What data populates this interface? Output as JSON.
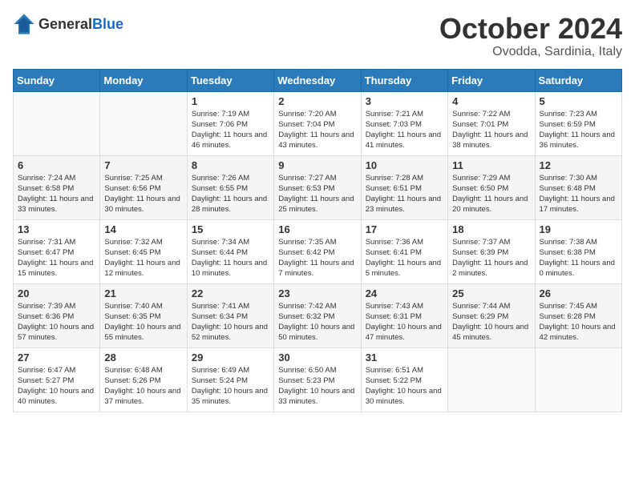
{
  "header": {
    "logo_general": "General",
    "logo_blue": "Blue",
    "month": "October 2024",
    "location": "Ovodda, Sardinia, Italy"
  },
  "weekdays": [
    "Sunday",
    "Monday",
    "Tuesday",
    "Wednesday",
    "Thursday",
    "Friday",
    "Saturday"
  ],
  "weeks": [
    [
      {
        "day": "",
        "info": ""
      },
      {
        "day": "",
        "info": ""
      },
      {
        "day": "1",
        "info": "Sunrise: 7:19 AM\nSunset: 7:06 PM\nDaylight: 11 hours and 46 minutes."
      },
      {
        "day": "2",
        "info": "Sunrise: 7:20 AM\nSunset: 7:04 PM\nDaylight: 11 hours and 43 minutes."
      },
      {
        "day": "3",
        "info": "Sunrise: 7:21 AM\nSunset: 7:03 PM\nDaylight: 11 hours and 41 minutes."
      },
      {
        "day": "4",
        "info": "Sunrise: 7:22 AM\nSunset: 7:01 PM\nDaylight: 11 hours and 38 minutes."
      },
      {
        "day": "5",
        "info": "Sunrise: 7:23 AM\nSunset: 6:59 PM\nDaylight: 11 hours and 36 minutes."
      }
    ],
    [
      {
        "day": "6",
        "info": "Sunrise: 7:24 AM\nSunset: 6:58 PM\nDaylight: 11 hours and 33 minutes."
      },
      {
        "day": "7",
        "info": "Sunrise: 7:25 AM\nSunset: 6:56 PM\nDaylight: 11 hours and 30 minutes."
      },
      {
        "day": "8",
        "info": "Sunrise: 7:26 AM\nSunset: 6:55 PM\nDaylight: 11 hours and 28 minutes."
      },
      {
        "day": "9",
        "info": "Sunrise: 7:27 AM\nSunset: 6:53 PM\nDaylight: 11 hours and 25 minutes."
      },
      {
        "day": "10",
        "info": "Sunrise: 7:28 AM\nSunset: 6:51 PM\nDaylight: 11 hours and 23 minutes."
      },
      {
        "day": "11",
        "info": "Sunrise: 7:29 AM\nSunset: 6:50 PM\nDaylight: 11 hours and 20 minutes."
      },
      {
        "day": "12",
        "info": "Sunrise: 7:30 AM\nSunset: 6:48 PM\nDaylight: 11 hours and 17 minutes."
      }
    ],
    [
      {
        "day": "13",
        "info": "Sunrise: 7:31 AM\nSunset: 6:47 PM\nDaylight: 11 hours and 15 minutes."
      },
      {
        "day": "14",
        "info": "Sunrise: 7:32 AM\nSunset: 6:45 PM\nDaylight: 11 hours and 12 minutes."
      },
      {
        "day": "15",
        "info": "Sunrise: 7:34 AM\nSunset: 6:44 PM\nDaylight: 11 hours and 10 minutes."
      },
      {
        "day": "16",
        "info": "Sunrise: 7:35 AM\nSunset: 6:42 PM\nDaylight: 11 hours and 7 minutes."
      },
      {
        "day": "17",
        "info": "Sunrise: 7:36 AM\nSunset: 6:41 PM\nDaylight: 11 hours and 5 minutes."
      },
      {
        "day": "18",
        "info": "Sunrise: 7:37 AM\nSunset: 6:39 PM\nDaylight: 11 hours and 2 minutes."
      },
      {
        "day": "19",
        "info": "Sunrise: 7:38 AM\nSunset: 6:38 PM\nDaylight: 11 hours and 0 minutes."
      }
    ],
    [
      {
        "day": "20",
        "info": "Sunrise: 7:39 AM\nSunset: 6:36 PM\nDaylight: 10 hours and 57 minutes."
      },
      {
        "day": "21",
        "info": "Sunrise: 7:40 AM\nSunset: 6:35 PM\nDaylight: 10 hours and 55 minutes."
      },
      {
        "day": "22",
        "info": "Sunrise: 7:41 AM\nSunset: 6:34 PM\nDaylight: 10 hours and 52 minutes."
      },
      {
        "day": "23",
        "info": "Sunrise: 7:42 AM\nSunset: 6:32 PM\nDaylight: 10 hours and 50 minutes."
      },
      {
        "day": "24",
        "info": "Sunrise: 7:43 AM\nSunset: 6:31 PM\nDaylight: 10 hours and 47 minutes."
      },
      {
        "day": "25",
        "info": "Sunrise: 7:44 AM\nSunset: 6:29 PM\nDaylight: 10 hours and 45 minutes."
      },
      {
        "day": "26",
        "info": "Sunrise: 7:45 AM\nSunset: 6:28 PM\nDaylight: 10 hours and 42 minutes."
      }
    ],
    [
      {
        "day": "27",
        "info": "Sunrise: 6:47 AM\nSunset: 5:27 PM\nDaylight: 10 hours and 40 minutes."
      },
      {
        "day": "28",
        "info": "Sunrise: 6:48 AM\nSunset: 5:26 PM\nDaylight: 10 hours and 37 minutes."
      },
      {
        "day": "29",
        "info": "Sunrise: 6:49 AM\nSunset: 5:24 PM\nDaylight: 10 hours and 35 minutes."
      },
      {
        "day": "30",
        "info": "Sunrise: 6:50 AM\nSunset: 5:23 PM\nDaylight: 10 hours and 33 minutes."
      },
      {
        "day": "31",
        "info": "Sunrise: 6:51 AM\nSunset: 5:22 PM\nDaylight: 10 hours and 30 minutes."
      },
      {
        "day": "",
        "info": ""
      },
      {
        "day": "",
        "info": ""
      }
    ]
  ]
}
